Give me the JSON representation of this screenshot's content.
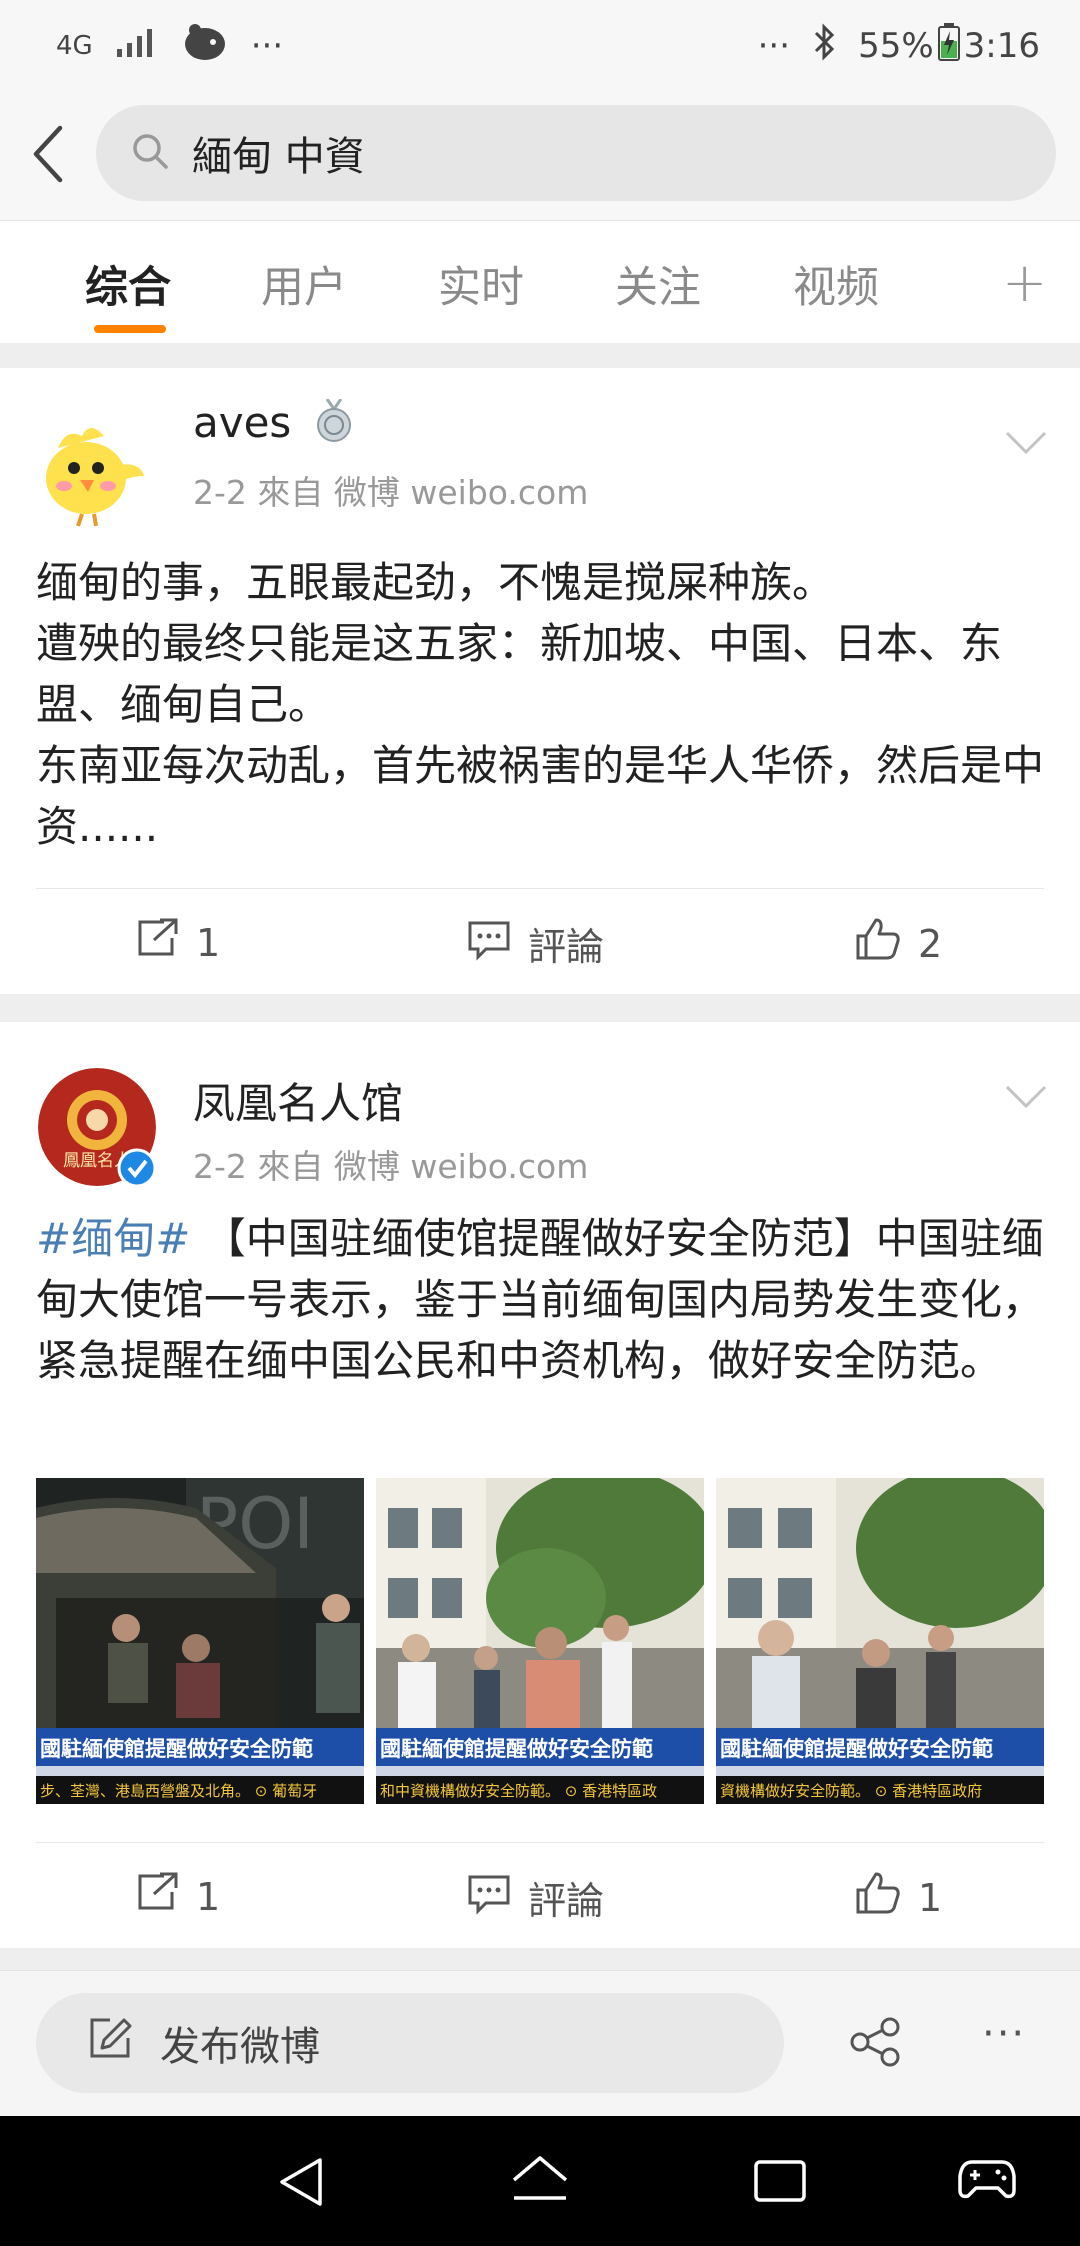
{
  "status_bar": {
    "network": "4G",
    "battery": "55%",
    "time": "3:16",
    "dots": "···"
  },
  "search": {
    "query": "緬甸 中資"
  },
  "tabs": [
    {
      "label": "综合",
      "active": true
    },
    {
      "label": "用户"
    },
    {
      "label": "实时"
    },
    {
      "label": "关注"
    },
    {
      "label": "视频"
    }
  ],
  "plus_label": "+",
  "posts": [
    {
      "author": "aves",
      "meta": "2-2   來自 微博 weibo.com",
      "text": "缅甸的事，五眼最起劲，不愧是搅屎种族。\n遭殃的最终只能是这五家：新加坡、中国、日本、东盟、缅甸自己。\n东南亚每次动乱，首先被祸害的是华人华侨，然后是中资......",
      "reposts": "1",
      "comments": "評論",
      "likes": "2"
    },
    {
      "author": "凤凰名人馆",
      "avatar_text": "鳳凰名人",
      "meta": "2-2   來自 微博 weibo.com",
      "topic": "#缅甸#",
      "text": " 【中国驻缅使馆提醒做好安全防范】中国驻缅甸大使馆一号表示，鉴于当前缅甸国内局势发生变化，紧急提醒在缅中国公民和中资机构，做好安全防范。",
      "reposts": "1",
      "comments": "評論",
      "likes": "1",
      "images": [
        {
          "headline": "國駐緬使館提醒做好安全防範",
          "ticker": "步、荃灣、港島西營盤及北角。 ⊙ 葡萄牙",
          "sign": "POI"
        },
        {
          "headline": "國駐緬使館提醒做好安全防範",
          "ticker": "和中資機構做好安全防範。 ⊙ 香港特區政"
        },
        {
          "headline": "國駐緬使館提醒做好安全防範",
          "ticker": "資機構做好安全防範。 ⊙ 香港特區政府"
        }
      ]
    }
  ],
  "bottom_bar": {
    "compose_label": "发布微博",
    "more": "···"
  },
  "colors": {
    "accent": "#ff8200",
    "topic": "#4a7fb5",
    "verified": "#1e88e5"
  }
}
